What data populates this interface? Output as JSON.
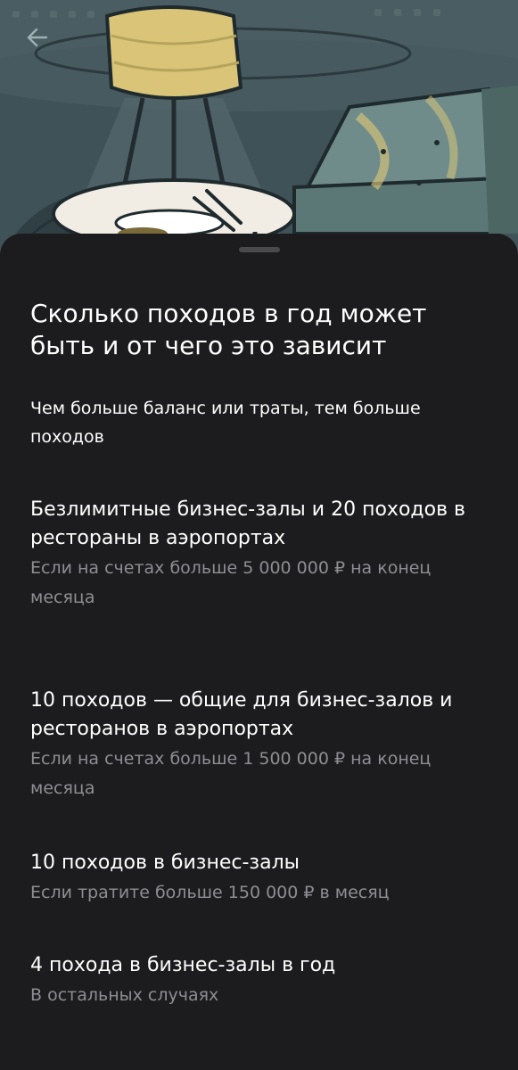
{
  "nav": {
    "back_icon": "arrow-left-icon"
  },
  "sheet": {
    "title": "Сколько походов в год может быть и от чего это зависит",
    "subtitle": "Чем больше баланс или траты, тем больше походов",
    "options": [
      {
        "title": "Безлимитные бизнес-залы и 20 походов в рестораны в аэропортах",
        "description": "Если на счетах больше 5 000 000 ₽ на конец месяца"
      },
      {
        "title": "10 походов — общие для бизнес-залов и ресторанов в аэропортах",
        "description": "Если на счетах больше 1 500 000 ₽ на конец месяца"
      },
      {
        "title": "10 походов в бизнес-залы",
        "description": "Если тратите больше 150 000 ₽ в месяц"
      },
      {
        "title": "4 похода в бизнес-залы в год",
        "description": "В остальных случаях"
      }
    ]
  },
  "colors": {
    "background": "#1c1c1e",
    "text_primary": "#ffffff",
    "text_secondary": "#8e8e93",
    "illustration_dark": "#3f5258",
    "illustration_accent": "#d9c478"
  }
}
